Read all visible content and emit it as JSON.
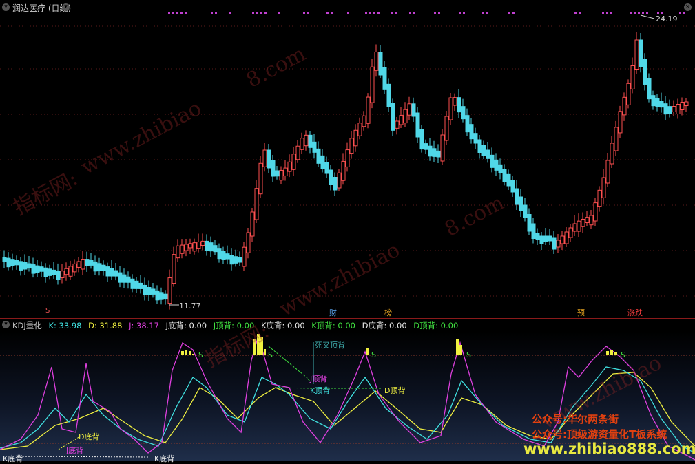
{
  "window": {
    "title": "润达医疗 (日线)"
  },
  "price_chart": {
    "high_label": "24.19",
    "low_label": "11.77"
  },
  "event_tags": {
    "s_mark": "S",
    "cai": "财",
    "bang": "榜",
    "yu": "预",
    "zhangdie": "涨跌"
  },
  "indicator": {
    "name": "KDJ量化",
    "k_label": "K: 33.98",
    "d_label": "D: 31.88",
    "j_label": "J: 38.17",
    "j_bottom": "J底背: 0.00",
    "j_top": "J顶背: 0.00",
    "k_bottom": "K底背: 0.00",
    "k_top": "K顶背: 0.00",
    "d_bottom": "D底背: 0.00",
    "d_top": "D顶背: 0.00",
    "colors": {
      "k": "#40e0e0",
      "d": "#f0f040",
      "j": "#e040e0"
    }
  },
  "annotations": {
    "dead_cross_top": "死叉顶背",
    "j_top": "J顶背",
    "k_top": "K顶背",
    "d_top": "D顶背",
    "d_bottom": "D底背",
    "j_bottom": "J底背",
    "k_bottom_left": "K底背",
    "k_bottom": "K底背",
    "s_label": "S"
  },
  "watermarks": {
    "a": "指标网:",
    "b": "www.zhibiao",
    "c": "8.com"
  },
  "promo": {
    "line1": "公众号:华尔两条街",
    "line2": "公众号:顶级游资量化T板系统",
    "site": "www.zhibiao888.com"
  }
}
